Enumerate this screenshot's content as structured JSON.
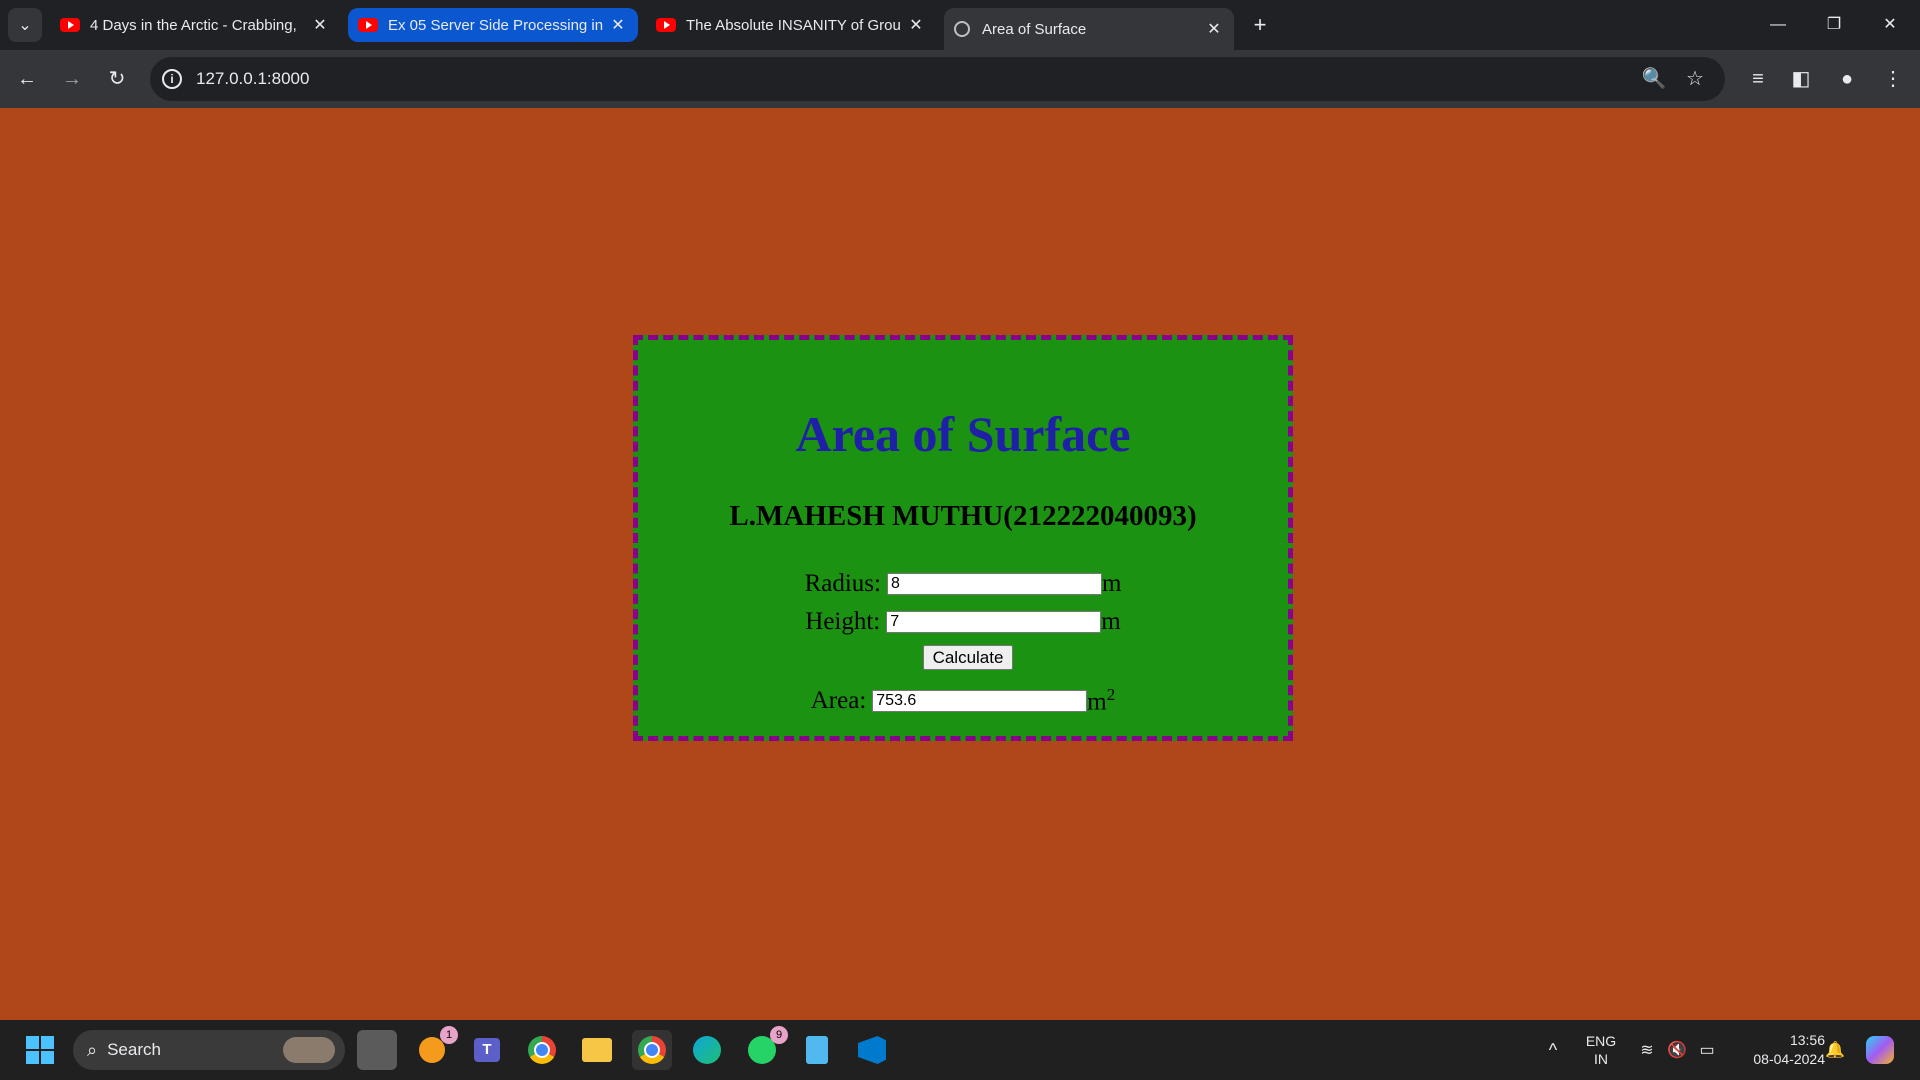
{
  "browser": {
    "tabs": [
      {
        "title": "4 Days in the Arctic - Crabbing,",
        "favicon": "youtube-icon"
      },
      {
        "title": "Ex 05 Server Side Processing in",
        "favicon": "youtube-icon"
      },
      {
        "title": "The Absolute INSANITY of Grou",
        "favicon": "youtube-icon"
      },
      {
        "title": "Area of Surface",
        "favicon": "globe-icon"
      }
    ],
    "url": "127.0.0.1:8000"
  },
  "page": {
    "title": "Area of Surface",
    "author": "L.MAHESH MUTHU(212222040093)",
    "radius_label": "Radius:",
    "radius_value": "8",
    "radius_unit": "m",
    "height_label": "Height:",
    "height_value": "7",
    "height_unit": "m",
    "calculate_label": "Calculate",
    "area_label": "Area:",
    "area_value": "753.6",
    "area_unit": "m",
    "area_unit_exponent": "2",
    "colors": {
      "background": "#b04718",
      "card": "#1c9212",
      "border": "#8b008b",
      "title": "#1f1fa8"
    }
  },
  "taskbar": {
    "search_label": "Search",
    "notification_badge": "1",
    "whatsapp_badge": "9",
    "language_top": "ENG",
    "language_bottom": "IN",
    "time": "13:56",
    "date": "08-04-2024"
  }
}
